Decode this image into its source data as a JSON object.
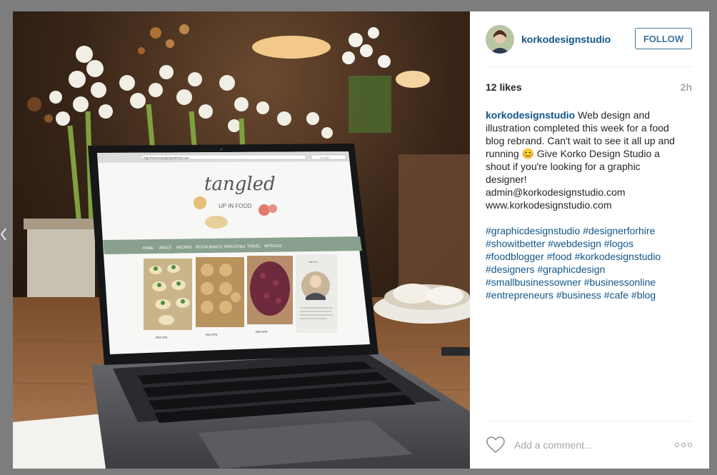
{
  "post": {
    "username": "korkodesignstudio",
    "follow_label": "FOLLOW",
    "likes": "12 likes",
    "time": "2h",
    "caption_user": "korkodesignstudio",
    "caption_lines": {
      "l1": "Web design and",
      "l2": "illustration completed this week for a food",
      "l3": "blog rebrand. Can't wait to see it all up and",
      "l4a": "running",
      "l4b": "Give Korko Design Studio a",
      "l5": "shout if you're looking for a graphic",
      "l6": "designer!",
      "l7": "admin@korkodesignstudio.com",
      "l8": "www.korkodesignstudio.com"
    },
    "emoji": "😊",
    "hashtags": [
      "#graphicdesignstudio",
      "#designerforhire",
      "#showitbetter",
      "#webdesign",
      "#logos",
      "#foodblogger",
      "#food",
      "#korkodesignstudio",
      "#designers",
      "#graphicdesign",
      "#smallbusinessowner",
      "#businessonline",
      "#entrepreneurs",
      "#business",
      "#cafe",
      "#blog"
    ],
    "comment_placeholder": "Add a comment...",
    "icons": {
      "heart": "heart-icon",
      "more": "more-options-icon",
      "prev": "chevron-left-icon"
    }
  },
  "photo_screen": {
    "url": "http://www.tangledupinfood.com",
    "search": "Google",
    "logo_top": "tangled",
    "logo_bottom": "UP IN FOOD",
    "nav": [
      "HOME",
      "ABOUT",
      "RECIPES",
      "RESTAURANTS",
      "TWIN CITIES",
      "TRAVEL",
      "ARTICLES"
    ],
    "card_label": "RECIPE",
    "about_label": "ABOUT"
  },
  "colors": {
    "link": "#125688",
    "follow": "#3f729b",
    "muted": "#a5a7aa",
    "nav_bar": "#8aa08f"
  }
}
